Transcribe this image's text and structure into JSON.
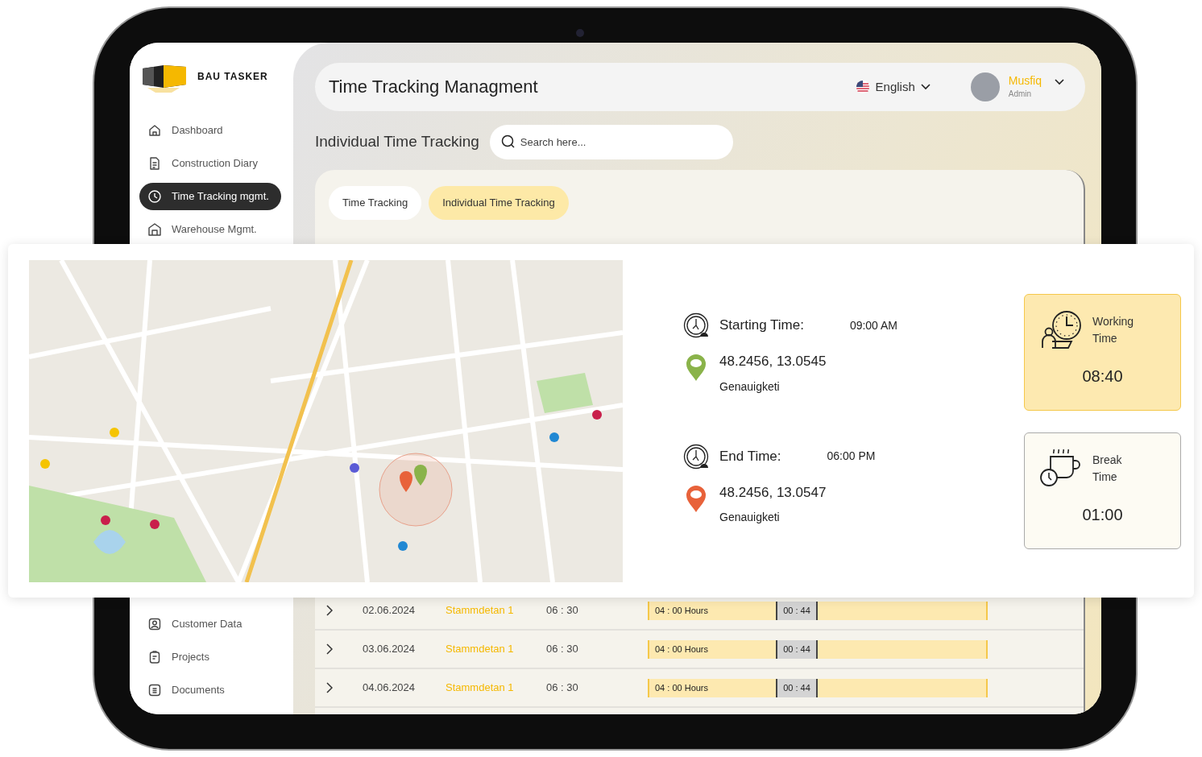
{
  "sidebar": {
    "logo_text": "BAU TASKER",
    "upper_items": [
      {
        "label": "Dashboard",
        "selected": false
      },
      {
        "label": "Construction Diary",
        "selected": false
      },
      {
        "label": "Time Tracking mgmt.",
        "selected": true
      },
      {
        "label": "Warehouse Mgmt.",
        "selected": false
      }
    ],
    "lower_items": [
      {
        "label": "Customer Data",
        "selected": false
      },
      {
        "label": "Projects",
        "selected": false
      },
      {
        "label": "Documents",
        "selected": false
      }
    ]
  },
  "header": {
    "title": "Time Tracking Managment",
    "language": "English",
    "user": {
      "name": "Musfiq",
      "role": "Admin"
    }
  },
  "page_title": "Individual Time Tracking",
  "search": {
    "placeholder": "Search here..."
  },
  "tabs": [
    {
      "label": "Time Tracking",
      "selected": false
    },
    {
      "label": "Individual Time Tracking",
      "selected": true
    }
  ],
  "rows": [
    {
      "date": "02.06.2024",
      "name": "Stammdetan 1",
      "time": "06 : 30",
      "work": "04 : 00 Hours",
      "break": "00 : 44"
    },
    {
      "date": "03.06.2024",
      "name": "Stammdetan 1",
      "time": "06 : 30",
      "work": "04 : 00 Hours",
      "break": "00 : 44"
    },
    {
      "date": "04.06.2024",
      "name": "Stammdetan 1",
      "time": "06 : 30",
      "work": "04 : 00 Hours",
      "break": "00 : 44"
    }
  ],
  "popup": {
    "events": [
      {
        "label": "Starting Time:",
        "time": "09:00 AM",
        "coords": "48.2456, 13.0545",
        "place": "Genauigketi",
        "color": "#8ab34a"
      },
      {
        "label": "End Time:",
        "time": "06:00 PM",
        "coords": "48.2456, 13.0547",
        "place": "Genauigketi",
        "color": "#e8623a"
      }
    ],
    "summary": [
      {
        "label": "Working Time",
        "value": "08:40",
        "highlighted": true
      },
      {
        "label": "Break Time",
        "value": "01:00",
        "highlighted": false
      }
    ]
  }
}
